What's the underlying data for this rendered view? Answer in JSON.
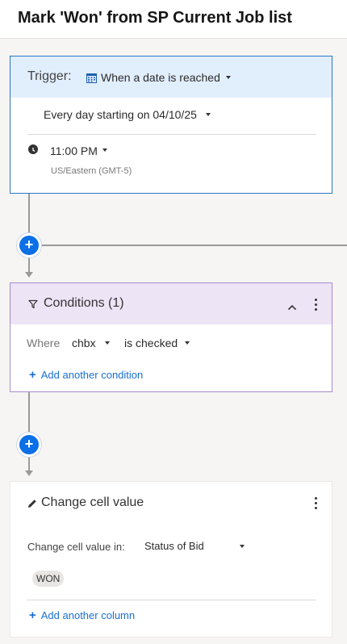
{
  "header": {
    "title": "Mark 'Won' from SP Current Job list"
  },
  "trigger": {
    "label": "Trigger:",
    "type_icon": "calendar-icon",
    "type": "When a date is reached",
    "schedule": "Every day starting on 04/10/25",
    "time_icon": "clock-icon",
    "time": "11:00 PM",
    "timezone": "US/Eastern (GMT-5)"
  },
  "add_step_icon": "+",
  "conditions": {
    "icon": "funnel-icon",
    "title": "Conditions (1)",
    "rows": [
      {
        "prefix": "Where",
        "field": "chbx",
        "operator": "is checked"
      }
    ],
    "add_label": "Add another condition"
  },
  "action": {
    "icon": "pencil-icon",
    "title": "Change cell value",
    "in_label": "Change cell value in:",
    "column": "Status of Bid",
    "value": "WON",
    "add_label": "Add another column"
  },
  "colors": {
    "accent_blue": "#0b6fe6",
    "trigger_border": "#2a76c7",
    "trigger_header": "#e1eefc",
    "condition_border": "#a88bd0",
    "condition_header": "#ede4f6",
    "link": "#1a6fd1"
  }
}
